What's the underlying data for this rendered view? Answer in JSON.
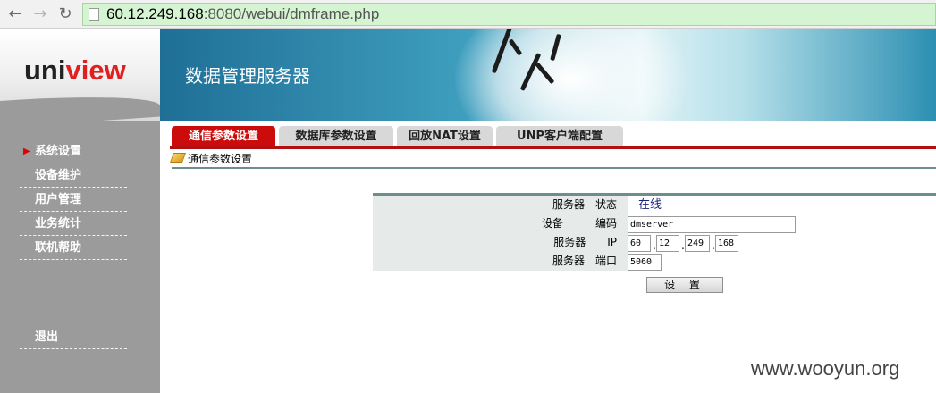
{
  "browser": {
    "url_host": "60.12.249.168",
    "url_rest": ":8080/webui/dmframe.php"
  },
  "logo": {
    "part1": "uni",
    "part2": "view"
  },
  "banner": {
    "title": "数据管理服务器"
  },
  "tabs": [
    {
      "label": "通信参数设置",
      "active": true
    },
    {
      "label": "数据库参数设置",
      "active": false
    },
    {
      "label": "回放NAT设置",
      "active": false
    },
    {
      "label": "UNP客户端配置",
      "active": false
    }
  ],
  "breadcrumb": "通信参数设置",
  "sidebar": {
    "items": [
      {
        "label": "系统设置",
        "selected": true
      },
      {
        "label": "设备维护"
      },
      {
        "label": "用户管理"
      },
      {
        "label": "业务统计"
      },
      {
        "label": "联机帮助"
      }
    ],
    "logout": "退出"
  },
  "form": {
    "rows": [
      {
        "label": "服务器　状态"
      },
      {
        "label": "设备　　　编码"
      },
      {
        "label": "服务器　　IP"
      },
      {
        "label": "服务器　端口"
      }
    ],
    "status_value": "在线",
    "device_code": "dmserver",
    "ip": [
      "60",
      "12",
      "249",
      "168"
    ],
    "port": "5060",
    "submit_label": "设 置"
  },
  "watermark": "www.wooyun.org",
  "colors": {
    "accent": "#cc0b0b",
    "sidebar": "#9b9b9b",
    "rule": "#6c8f8c"
  }
}
